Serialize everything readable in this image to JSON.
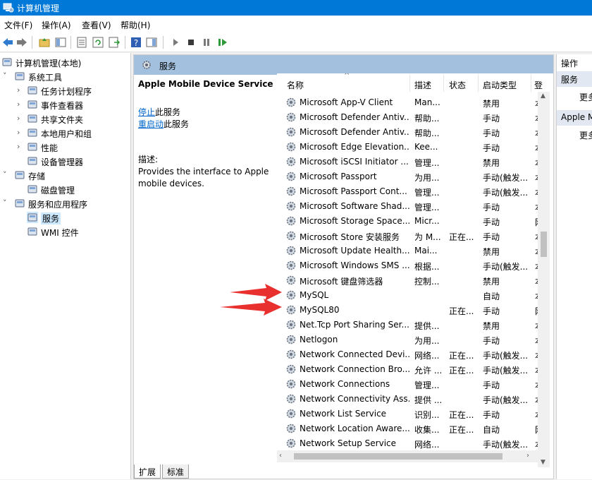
{
  "window": {
    "title": "计算机管理"
  },
  "menu": [
    "文件(F)",
    "操作(A)",
    "查看(V)",
    "帮助(H)"
  ],
  "tree": [
    {
      "label": "计算机管理(本地)",
      "icon": "computer-management-icon",
      "level": 0,
      "arrow": ""
    },
    {
      "label": "系统工具",
      "icon": "tools-icon",
      "level": 1,
      "arrow": "v"
    },
    {
      "label": "任务计划程序",
      "icon": "clock-icon",
      "level": 2,
      "arrow": ">"
    },
    {
      "label": "事件查看器",
      "icon": "event-viewer-icon",
      "level": 2,
      "arrow": ">"
    },
    {
      "label": "共享文件夹",
      "icon": "shared-folder-icon",
      "level": 2,
      "arrow": ">"
    },
    {
      "label": "本地用户和组",
      "icon": "users-icon",
      "level": 2,
      "arrow": ">"
    },
    {
      "label": "性能",
      "icon": "performance-icon",
      "level": 2,
      "arrow": ">"
    },
    {
      "label": "设备管理器",
      "icon": "device-manager-icon",
      "level": 2,
      "arrow": ""
    },
    {
      "label": "存储",
      "icon": "storage-icon",
      "level": 1,
      "arrow": "v"
    },
    {
      "label": "磁盘管理",
      "icon": "disk-icon",
      "level": 2,
      "arrow": ""
    },
    {
      "label": "服务和应用程序",
      "icon": "services-apps-icon",
      "level": 1,
      "arrow": "v"
    },
    {
      "label": "服务",
      "icon": "gear-icon",
      "level": 2,
      "arrow": "",
      "selected": true
    },
    {
      "label": "WMI 控件",
      "icon": "wmi-icon",
      "level": 2,
      "arrow": ""
    }
  ],
  "center": {
    "header": "服务",
    "service_name": "Apple Mobile Device Service",
    "stop_link": "停止",
    "stop_suffix": "此服务",
    "restart_link": "重启动",
    "restart_suffix": "此服务",
    "desc_label": "描述:",
    "desc_text": "Provides the interface to Apple mobile devices."
  },
  "columns": {
    "name": "名称",
    "desc": "描述",
    "status": "状态",
    "startup": "启动类型",
    "logon": "登"
  },
  "services": [
    {
      "name": "Microsoft App-V Client",
      "desc": "Man...",
      "status": "",
      "startup": "禁用",
      "logon": "本"
    },
    {
      "name": "Microsoft Defender Antiv...",
      "desc": "帮助...",
      "status": "",
      "startup": "手动",
      "logon": "本"
    },
    {
      "name": "Microsoft Defender Antiv...",
      "desc": "帮助...",
      "status": "",
      "startup": "手动",
      "logon": "本"
    },
    {
      "name": "Microsoft Edge Elevation...",
      "desc": "Kee...",
      "status": "",
      "startup": "手动",
      "logon": "本"
    },
    {
      "name": "Microsoft iSCSI Initiator ...",
      "desc": "管理...",
      "status": "",
      "startup": "禁用",
      "logon": "本"
    },
    {
      "name": "Microsoft Passport",
      "desc": "为用...",
      "status": "",
      "startup": "手动(触发...",
      "logon": "本"
    },
    {
      "name": "Microsoft Passport Cont...",
      "desc": "管理...",
      "status": "",
      "startup": "手动(触发...",
      "logon": "本"
    },
    {
      "name": "Microsoft Software Shad...",
      "desc": "管理...",
      "status": "",
      "startup": "手动",
      "logon": "本"
    },
    {
      "name": "Microsoft Storage Space...",
      "desc": "Micr...",
      "status": "",
      "startup": "手动",
      "logon": "网"
    },
    {
      "name": "Microsoft Store 安装服务",
      "desc": "为 M...",
      "status": "正在...",
      "startup": "手动",
      "logon": "本"
    },
    {
      "name": "Microsoft Update Health...",
      "desc": "Mai...",
      "status": "",
      "startup": "禁用",
      "logon": "本"
    },
    {
      "name": "Microsoft Windows SMS ...",
      "desc": "根据...",
      "status": "",
      "startup": "手动(触发...",
      "logon": "本"
    },
    {
      "name": "Microsoft 键盘筛选器",
      "desc": "控制...",
      "status": "",
      "startup": "禁用",
      "logon": "本"
    },
    {
      "name": "MySQL",
      "desc": "",
      "status": "",
      "startup": "自动",
      "logon": "本"
    },
    {
      "name": "MySQL80",
      "desc": "",
      "status": "正在...",
      "startup": "手动",
      "logon": "网"
    },
    {
      "name": "Net.Tcp Port Sharing Ser...",
      "desc": "提供...",
      "status": "",
      "startup": "禁用",
      "logon": "本"
    },
    {
      "name": "Netlogon",
      "desc": "为用...",
      "status": "",
      "startup": "手动",
      "logon": "本"
    },
    {
      "name": "Network Connected Devi...",
      "desc": "网络...",
      "status": "正在...",
      "startup": "手动(触发...",
      "logon": "本"
    },
    {
      "name": "Network Connection Bro...",
      "desc": "允许 ...",
      "status": "正在...",
      "startup": "手动(触发...",
      "logon": "本"
    },
    {
      "name": "Network Connections",
      "desc": "管理...",
      "status": "",
      "startup": "手动",
      "logon": "本"
    },
    {
      "name": "Network Connectivity Ass...",
      "desc": "提供 ...",
      "status": "",
      "startup": "手动(触发...",
      "logon": "本"
    },
    {
      "name": "Network List Service",
      "desc": "识别...",
      "status": "正在...",
      "startup": "手动",
      "logon": "本"
    },
    {
      "name": "Network Location Aware...",
      "desc": "收集...",
      "status": "正在...",
      "startup": "自动",
      "logon": "网"
    },
    {
      "name": "Network Setup Service",
      "desc": "网络...",
      "status": "",
      "startup": "手动(触发...",
      "logon": "本"
    }
  ],
  "tabs": [
    "扩展",
    "标准"
  ],
  "actions": {
    "header": "操作",
    "section1": "服务",
    "more1": "更多",
    "section2": "Apple Mobile Device Service",
    "more2": "更多"
  },
  "colors": {
    "titlebar": "#0078d7",
    "header_strip": "#a3c1de",
    "selection": "#cce8ff",
    "annotation_arrow": "#e8312f"
  }
}
